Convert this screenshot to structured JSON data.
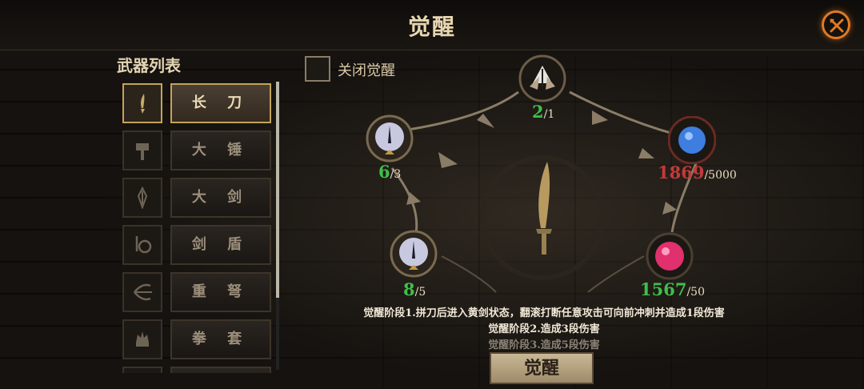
{
  "header": {
    "title": "觉醒",
    "close_icon": "close-x-icon"
  },
  "weapon_list": {
    "title": "武器列表",
    "items": [
      {
        "label": "长 刀",
        "icon": "long-blade-icon",
        "selected": true
      },
      {
        "label": "大 锤",
        "icon": "great-hammer-icon",
        "selected": false
      },
      {
        "label": "大 剑",
        "icon": "great-sword-icon",
        "selected": false
      },
      {
        "label": "剑 盾",
        "icon": "sword-shield-icon",
        "selected": false
      },
      {
        "label": "重 弩",
        "icon": "heavy-crossbow-icon",
        "selected": false
      },
      {
        "label": "拳 套",
        "icon": "gauntlet-icon",
        "selected": false
      }
    ]
  },
  "toggle": {
    "label": "关闭觉醒",
    "checked": false
  },
  "nodes": {
    "top": {
      "value": "2",
      "max": "/1",
      "icon": "crystal-cluster-icon"
    },
    "upper_left": {
      "value": "6",
      "max": "/3",
      "icon": "eye-orb-icon"
    },
    "lower_left": {
      "value": "8",
      "max": "/5",
      "icon": "eye-orb-icon"
    },
    "upper_right": {
      "value": "1869",
      "max": "/5000",
      "icon": "blue-orb-icon"
    },
    "lower_right": {
      "value": "1567",
      "max": "/50",
      "icon": "pink-orb-icon"
    }
  },
  "center": {
    "icon": "long-blade-silhouette-icon"
  },
  "descriptions": {
    "stage1": "觉醒阶段1.拼刀后进入黄剑状态，翻滚打断任意攻击可向前冲刺并造成1段伤害",
    "stage2": "觉醒阶段2.造成3段伤害",
    "stage3": "觉醒阶段3.造成5段伤害"
  },
  "awaken_button": {
    "label": "觉醒"
  },
  "colors": {
    "accent": "#e07a24",
    "gold": "#c4a35a",
    "green": "#3fbf4a",
    "red": "#c23a3a"
  }
}
